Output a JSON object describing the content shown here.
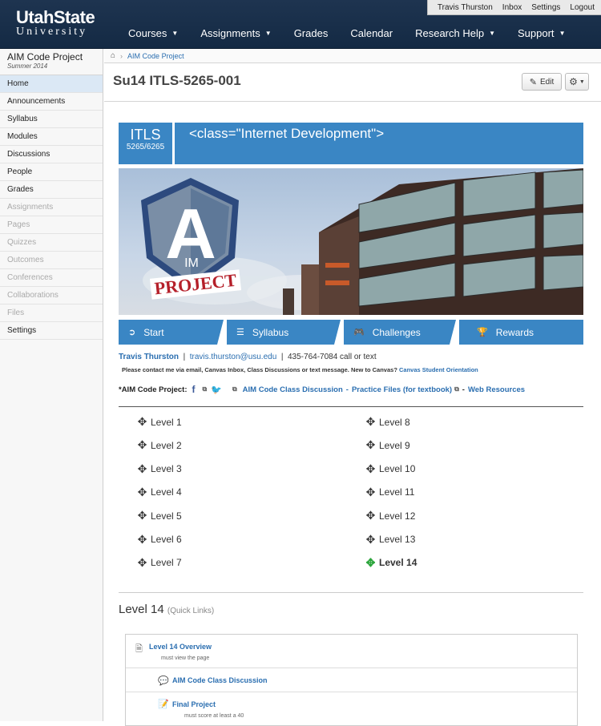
{
  "header": {
    "logo_line1": "UtahState",
    "logo_line2": "University",
    "user_nav": [
      "Travis Thurston",
      "Inbox",
      "Settings",
      "Logout"
    ],
    "main_nav": [
      {
        "label": "Courses",
        "caret": true
      },
      {
        "label": "Assignments",
        "caret": true
      },
      {
        "label": "Grades",
        "caret": false
      },
      {
        "label": "Calendar",
        "caret": false
      },
      {
        "label": "Research Help",
        "caret": true
      },
      {
        "label": "Support",
        "caret": true
      }
    ]
  },
  "sidebar": {
    "course_title": "AIM Code Project",
    "term": "Summer 2014",
    "items": [
      {
        "label": "Home",
        "state": "active"
      },
      {
        "label": "Announcements",
        "state": "normal"
      },
      {
        "label": "Syllabus",
        "state": "normal"
      },
      {
        "label": "Modules",
        "state": "normal"
      },
      {
        "label": "Discussions",
        "state": "normal"
      },
      {
        "label": "People",
        "state": "normal"
      },
      {
        "label": "Grades",
        "state": "normal"
      },
      {
        "label": "Assignments",
        "state": "disabled"
      },
      {
        "label": "Pages",
        "state": "disabled"
      },
      {
        "label": "Quizzes",
        "state": "disabled"
      },
      {
        "label": "Outcomes",
        "state": "disabled"
      },
      {
        "label": "Conferences",
        "state": "disabled"
      },
      {
        "label": "Collaborations",
        "state": "disabled"
      },
      {
        "label": "Files",
        "state": "disabled"
      },
      {
        "label": "Settings",
        "state": "normal"
      }
    ]
  },
  "breadcrumb": {
    "home_icon": "home-icon",
    "current": "AIM Code Project"
  },
  "page": {
    "title": "Su14 ITLS-5265-001",
    "edit_label": "Edit",
    "edit_icon": "pencil-icon",
    "settings_icon": "gear-icon"
  },
  "banner": {
    "code_line1": "ITLS",
    "code_line2": "5265/6265",
    "title": "<class=\"Internet Development\">",
    "color": "#3a86c4"
  },
  "hero": {
    "logo_letter_a": "A",
    "logo_im": "IM",
    "logo_project": "PROJECT"
  },
  "buttons": [
    {
      "label": "Start",
      "icon": "arrow-circle-icon",
      "glyph": "➲"
    },
    {
      "label": "Syllabus",
      "icon": "list-icon",
      "glyph": "☰"
    },
    {
      "label": "Challenges",
      "icon": "gamepad-icon",
      "glyph": "🎮"
    },
    {
      "label": "Rewards",
      "icon": "trophy-icon",
      "glyph": "🏆"
    }
  ],
  "contact": {
    "name": "Travis Thurston",
    "email": "travis.thurston@usu.edu",
    "phone": "435-764-7084 call or text",
    "note": "Please contact me via email, Canvas Inbox, Class Discussions or text message. New to Canvas?",
    "note_link": "Canvas Student Orientation"
  },
  "aim_line": {
    "label": "*AIM Code Project:",
    "discussion_link": "AIM Code Class Discussion",
    "practice_link": "Practice Files (for textbook)",
    "web_link": "Web Resources",
    "dash": "-"
  },
  "levels": {
    "left": [
      "Level 1",
      "Level 2",
      "Level 3",
      "Level 4",
      "Level 5",
      "Level 6",
      "Level 7"
    ],
    "right": [
      "Level 8",
      "Level 9",
      "Level 10",
      "Level 11",
      "Level 12",
      "Level 13",
      "Level 14"
    ],
    "current": "Level 14",
    "current_color": "#2aa43a"
  },
  "quick_links": {
    "title": "Level 14",
    "subtitle": "(Quick Links)",
    "items": [
      {
        "label": "Level 14 Overview",
        "note": "must view the page",
        "icon": "document-icon"
      },
      {
        "label": "AIM Code Class Discussion",
        "note": "",
        "icon": "discussion-icon"
      },
      {
        "label": "Final Project",
        "note": "must score at least a 40",
        "icon": "assignment-icon"
      }
    ]
  }
}
